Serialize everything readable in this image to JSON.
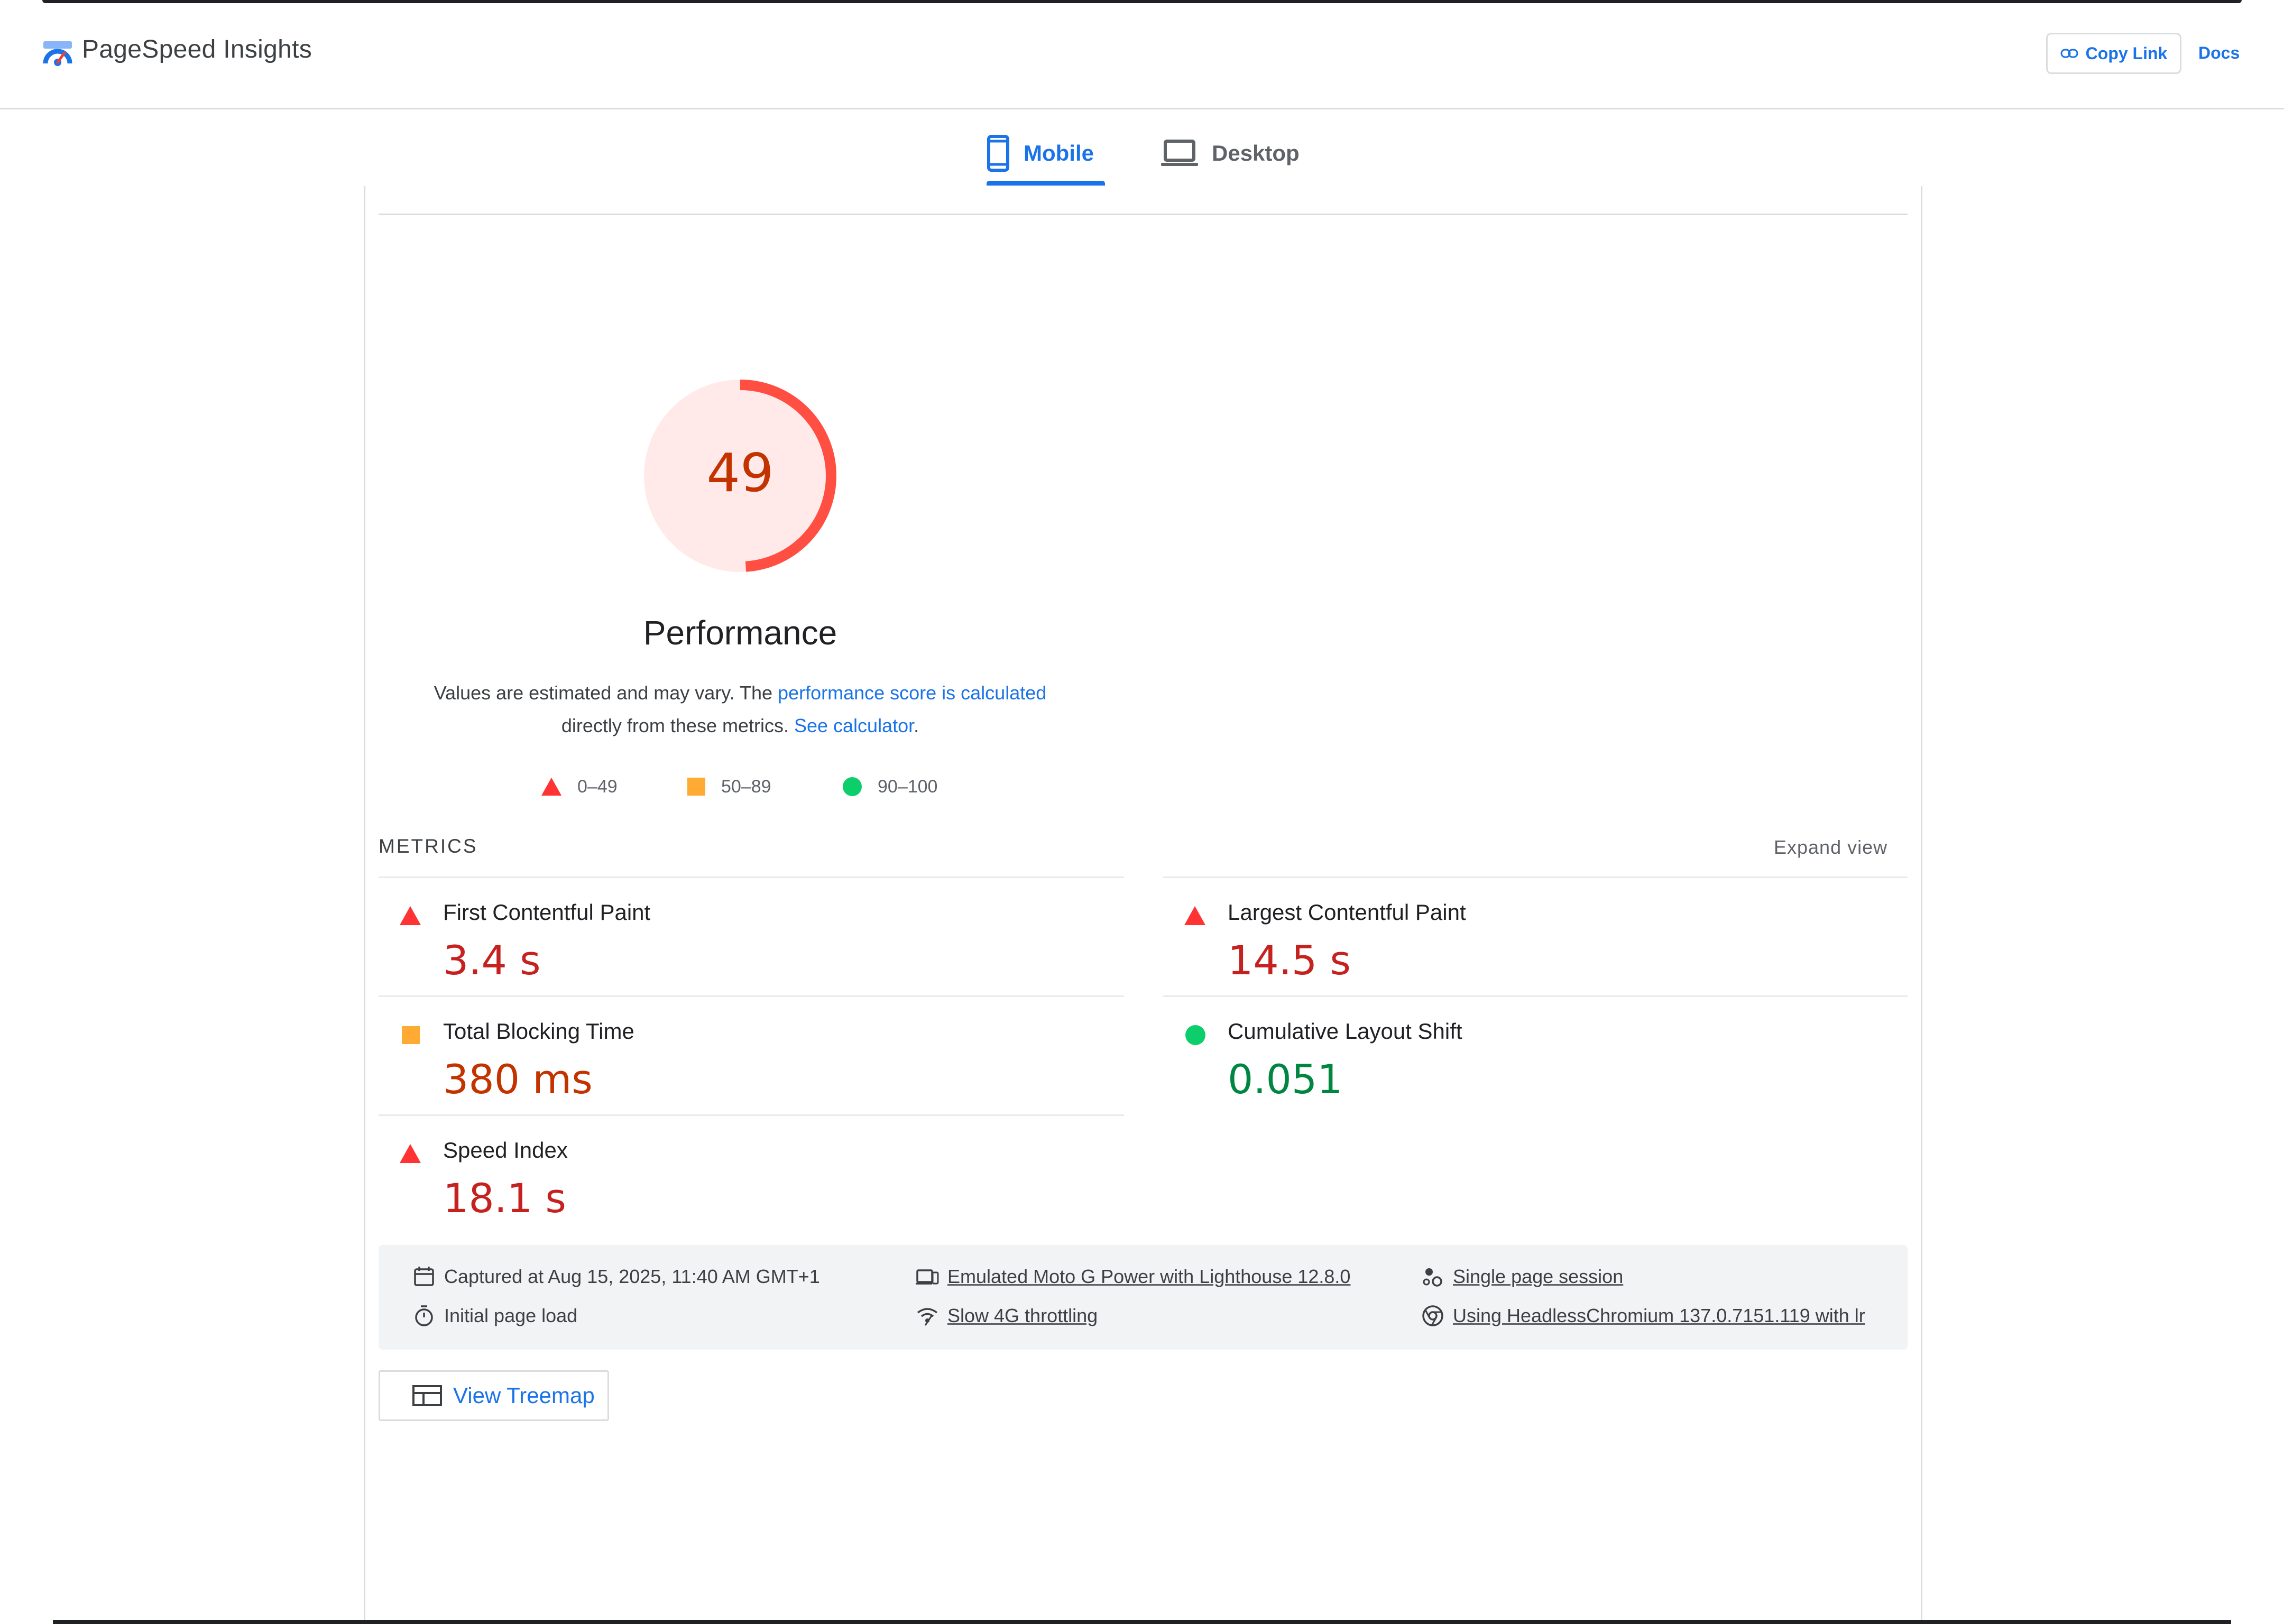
{
  "header": {
    "app_title": "PageSpeed Insights",
    "copy_link_label": "Copy Link",
    "docs_label": "Docs"
  },
  "tabs": [
    {
      "label": "Mobile",
      "selected": true
    },
    {
      "label": "Desktop",
      "selected": false
    }
  ],
  "performance": {
    "score": "49",
    "score_fraction": 0.49,
    "label": "Performance",
    "desc_prefix": "Values are estimated and may vary. The ",
    "desc_link1": "performance score is calculated",
    "desc_middle": "directly from these metrics. ",
    "desc_link2": "See calculator",
    "desc_suffix": "."
  },
  "scale": [
    {
      "range": "0–49",
      "shape": "triangle",
      "color": "#ff3333"
    },
    {
      "range": "50–89",
      "shape": "square",
      "color": "#ffaa33"
    },
    {
      "range": "90–100",
      "shape": "circle",
      "color": "#0cce6b"
    }
  ],
  "metrics": {
    "title": "METRICS",
    "expand_label": "Expand view",
    "items": [
      {
        "name": "First Contentful Paint",
        "value": "3.4 s",
        "status": "fail"
      },
      {
        "name": "Largest Contentful Paint",
        "value": "14.5 s",
        "status": "fail"
      },
      {
        "name": "Total Blocking Time",
        "value": "380 ms",
        "status": "average"
      },
      {
        "name": "Cumulative Layout Shift",
        "value": "0.051",
        "status": "pass"
      },
      {
        "name": "Speed Index",
        "value": "18.1 s",
        "status": "fail"
      }
    ]
  },
  "environment": {
    "captured": "Captured at Aug 15, 2025, 11:40 AM GMT+1",
    "initial_load": "Initial page load",
    "device": "Emulated Moto G Power with Lighthouse 12.8.0",
    "throttling": "Slow 4G throttling",
    "session": "Single page session",
    "browser": "Using HeadlessChromium 137.0.7151.119 with lr"
  },
  "treemap_label": "View Treemap",
  "colors": {
    "accent": "#1a73e8",
    "fail": "#ff3333",
    "average": "#ffaa33",
    "pass": "#0cce6b",
    "gauge_fill": "#ffeae9"
  }
}
